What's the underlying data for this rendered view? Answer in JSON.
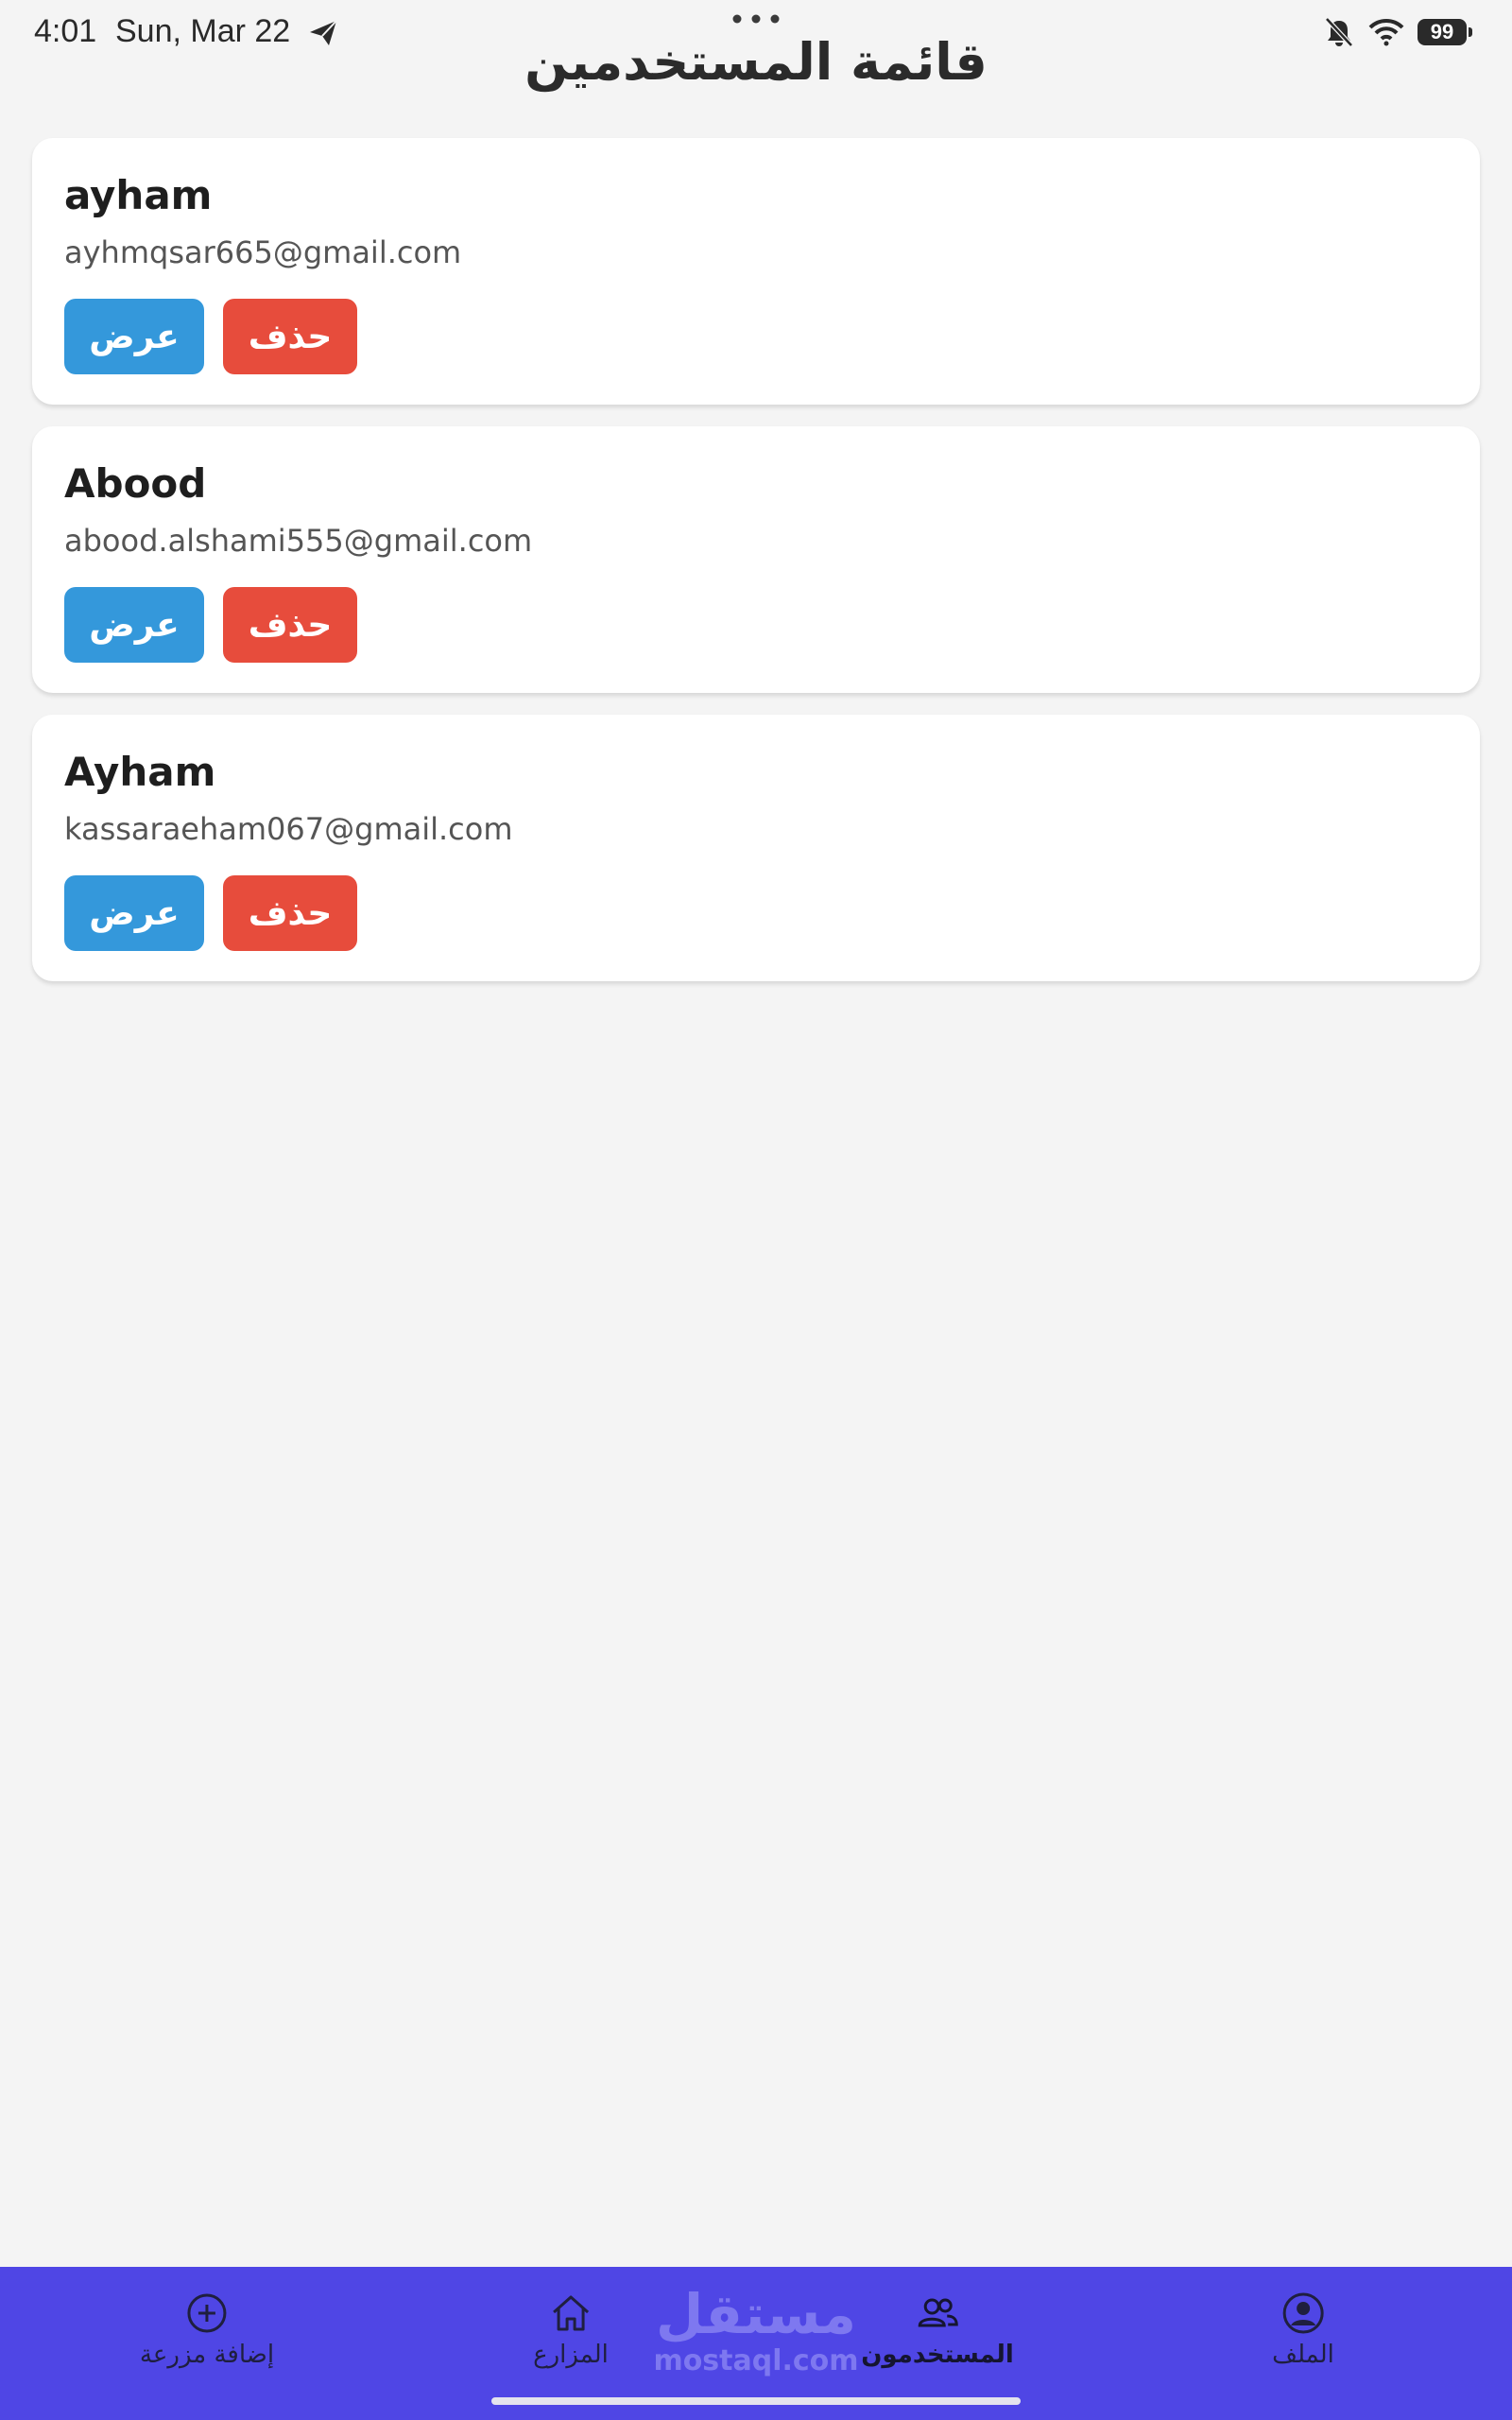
{
  "status_bar": {
    "time": "4:01",
    "date": "Sun, Mar 22",
    "battery": "99",
    "icons": [
      "telegram-send-icon",
      "bell-off-icon",
      "wifi-icon",
      "battery-icon"
    ]
  },
  "page": {
    "title": "قائمة المستخدمين"
  },
  "users": [
    {
      "name": "ayham",
      "email": "ayhmqsar665@gmail.com",
      "view_label": "عرض",
      "delete_label": "حذف"
    },
    {
      "name": "Abood",
      "email": "abood.alshami555@gmail.com",
      "view_label": "عرض",
      "delete_label": "حذف"
    },
    {
      "name": "Ayham",
      "email": "kassaraeham067@gmail.com",
      "view_label": "عرض",
      "delete_label": "حذف"
    }
  ],
  "bottom_nav": {
    "items": [
      {
        "label": "الملف",
        "icon": "user-circle-icon",
        "active": false
      },
      {
        "label": "المستخدمون",
        "icon": "users-icon",
        "active": true
      },
      {
        "label": "المزارع",
        "icon": "home-icon",
        "active": false
      },
      {
        "label": "إضافة مزرعة",
        "icon": "plus-circle-icon",
        "active": false
      }
    ]
  },
  "watermark": {
    "arabic": "مستقل",
    "latin": "mostaql.com"
  },
  "colors": {
    "background": "#f4f4f4",
    "view_button": "#3498db",
    "delete_button": "#e74c3c",
    "nav_bar": "#4f46e5"
  }
}
